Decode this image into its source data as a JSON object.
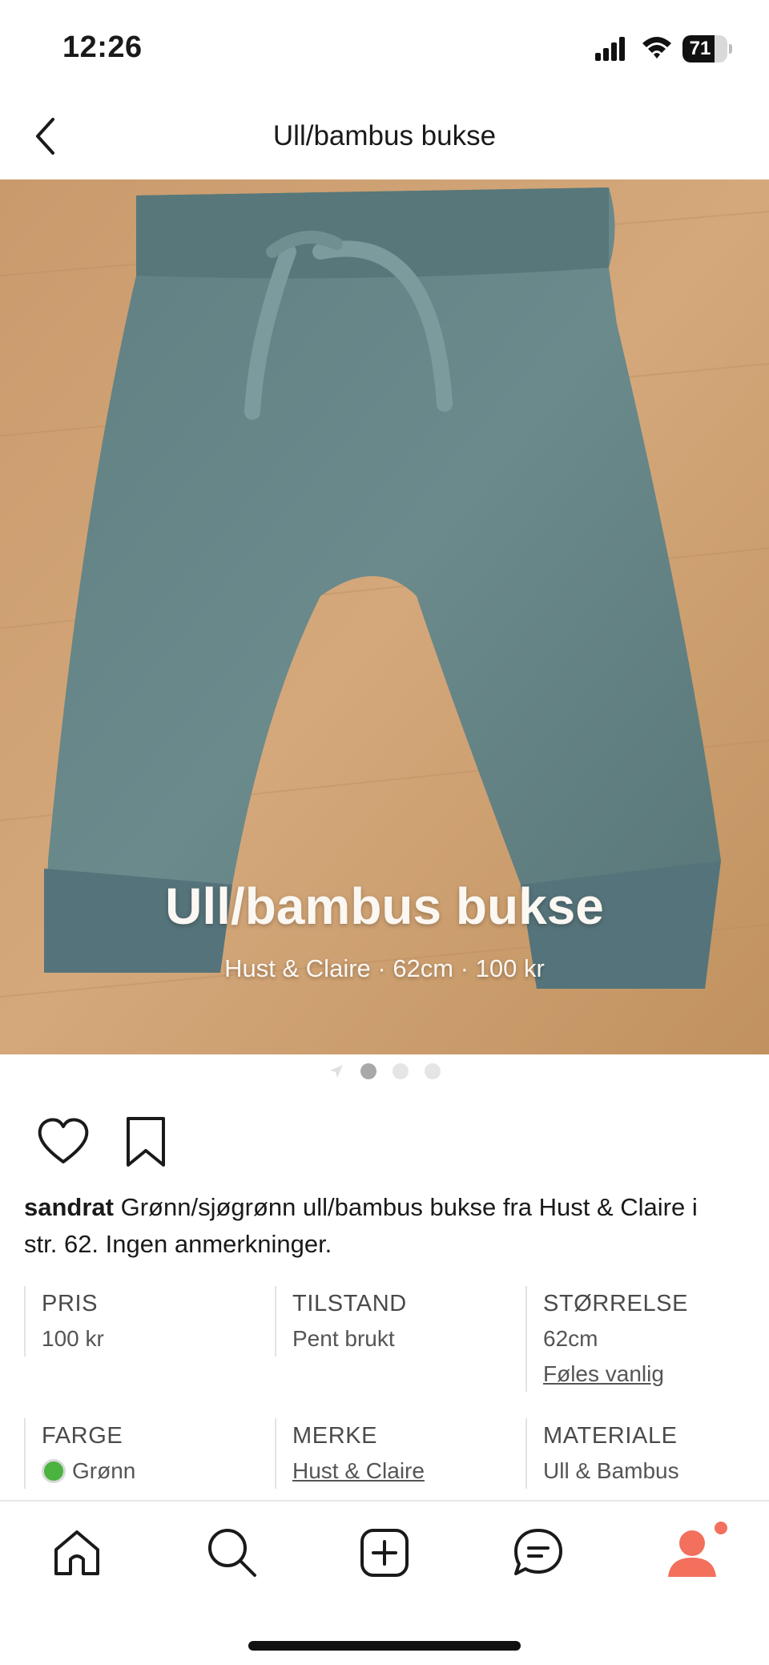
{
  "status_bar": {
    "time": "12:26",
    "battery_level": "71"
  },
  "nav": {
    "title": "Ull/bambus bukse",
    "back_icon": "chevron-left-icon"
  },
  "hero": {
    "title": "Ull/bambus bukse",
    "subtitle": "Hust & Claire · 62cm · 100 kr",
    "image_description": "photo of green baby trousers on wooden table",
    "page_count": 3,
    "active_page": 1
  },
  "actions": {
    "like_icon": "heart-icon",
    "save_icon": "bookmark-icon"
  },
  "description": {
    "seller": "sandrat",
    "text": " Grønn/sjøgrønn ull/bambus bukse fra Hust & Claire i str. 62. Ingen anmerkninger."
  },
  "details": {
    "price_label": "PRIS",
    "price_value": "100 kr",
    "condition_label": "TILSTAND",
    "condition_value": "Pent brukt",
    "size_label": "STØRRELSE",
    "size_value": "62cm",
    "size_fit": "Føles vanlig",
    "color_label": "FARGE",
    "color_value": "Grønn",
    "color_hex": "#4bb33f",
    "brand_label": "MERKE",
    "brand_value": "Hust & Claire",
    "material_label": "MATERIALE",
    "material_value": "Ull & Bambus"
  },
  "tab_bar": {
    "tabs": [
      "home-icon",
      "search-icon",
      "add-icon",
      "messages-icon",
      "profile-icon"
    ],
    "accent_color": "#f2705c"
  }
}
